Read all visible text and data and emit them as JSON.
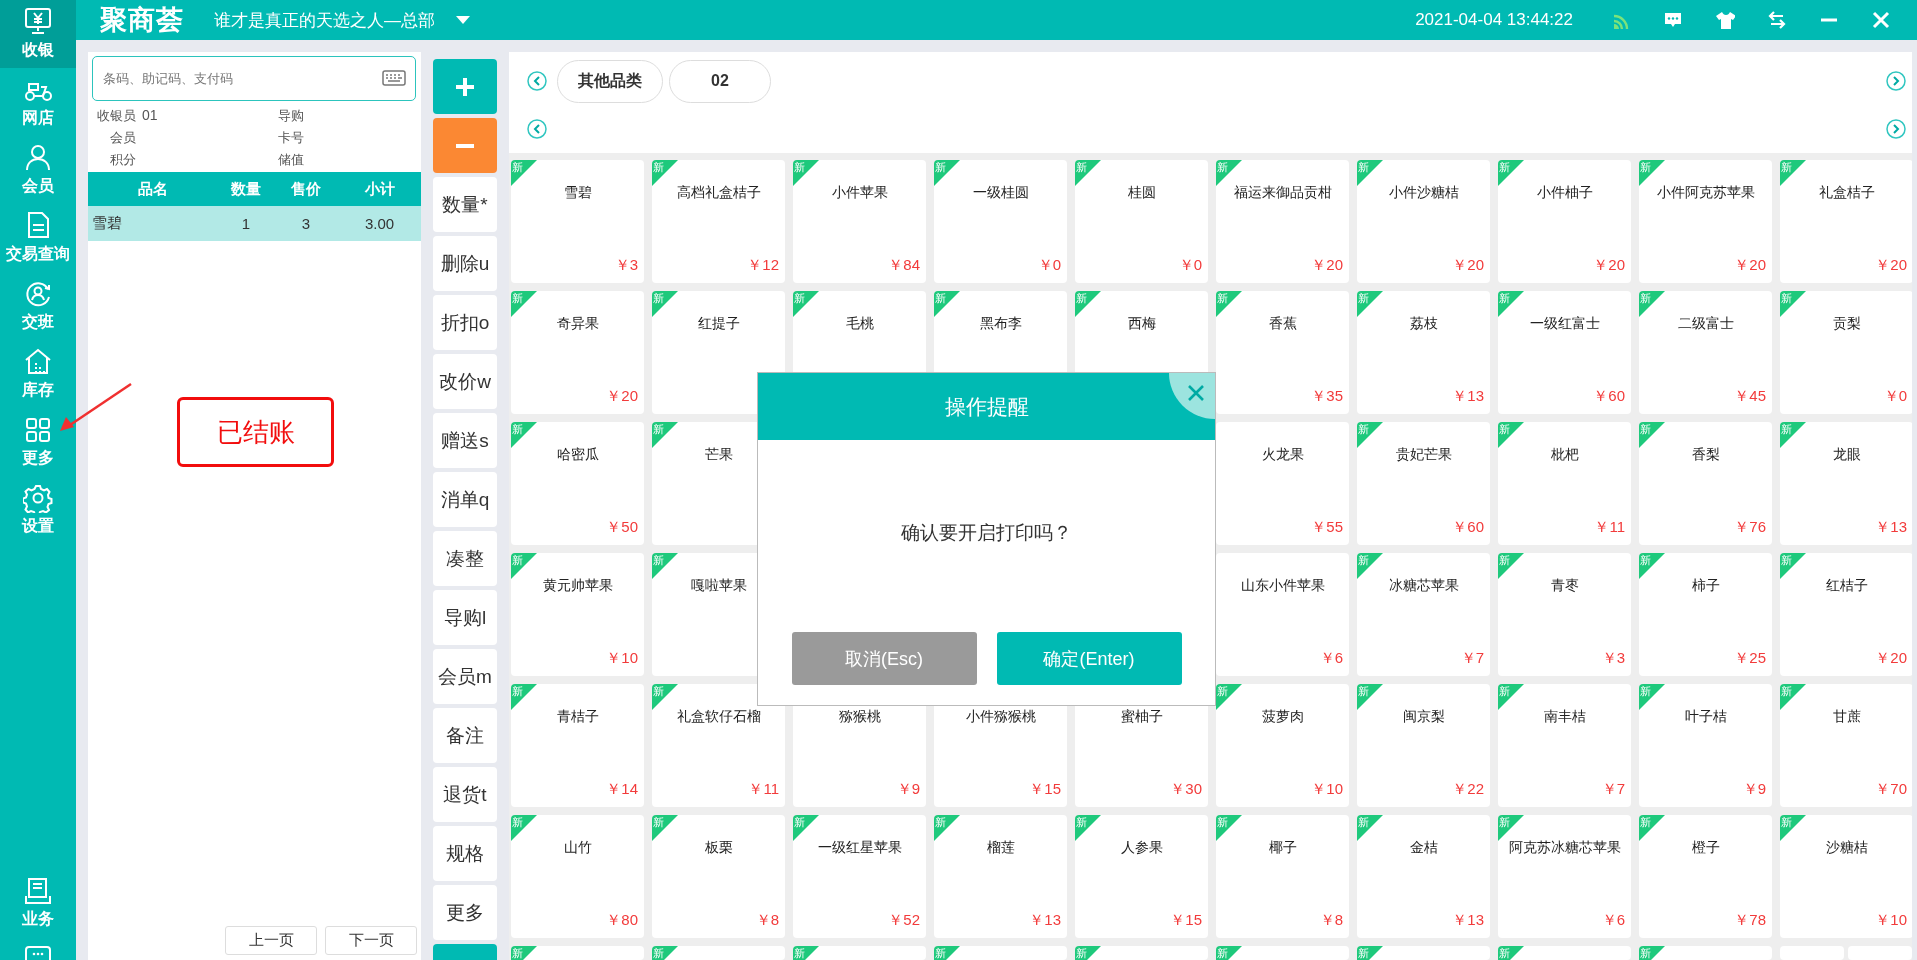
{
  "topbar": {
    "logo": "聚商荟",
    "store": "谁才是真正的天选之人—总部",
    "datetime": "2021-04-04 13:44:22"
  },
  "sidebar": {
    "items": [
      {
        "label": "收银",
        "selected": true
      },
      {
        "label": "网店",
        "selected": false
      },
      {
        "label": "会员",
        "selected": false
      },
      {
        "label": "交易查询",
        "selected": false
      },
      {
        "label": "交班",
        "selected": false
      },
      {
        "label": "库存",
        "selected": false
      },
      {
        "label": "更多",
        "selected": false
      },
      {
        "label": "设置",
        "selected": false
      }
    ],
    "bottom_items": [
      {
        "label": "业务",
        "kind": "full"
      },
      {
        "kind": "cut"
      }
    ]
  },
  "cart": {
    "search": {
      "placeholder": "条码、助记码、支付码"
    },
    "info": [
      {
        "label": "收银员",
        "value": "01"
      },
      {
        "label": "导购"
      },
      {
        "label": "会员"
      },
      {
        "label": "卡号"
      },
      {
        "label": "积分"
      },
      {
        "label": "储值"
      }
    ],
    "columns": [
      "品名",
      "数量",
      "售价",
      "小计"
    ],
    "rows": [
      {
        "cells": [
          "雪碧",
          "1",
          "3",
          "3.00"
        ],
        "selected": true
      }
    ],
    "pager": [
      "上一页",
      "下一页"
    ]
  },
  "actions": [
    {
      "kind": "add"
    },
    {
      "kind": "remove"
    },
    {
      "kind": "text",
      "label": "数量*"
    },
    {
      "kind": "text",
      "label": "删除u"
    },
    {
      "kind": "text",
      "label": "折扣o"
    },
    {
      "kind": "text",
      "label": "改价w"
    },
    {
      "kind": "text",
      "label": "赠送s"
    },
    {
      "kind": "text",
      "label": "消单q"
    },
    {
      "kind": "text",
      "label": "凑整"
    },
    {
      "kind": "text",
      "label": "导购l"
    },
    {
      "kind": "text",
      "label": "会员m"
    },
    {
      "kind": "text",
      "label": "备注"
    },
    {
      "kind": "text",
      "label": "退货t"
    },
    {
      "kind": "text",
      "label": "规格"
    },
    {
      "kind": "text",
      "label": "更多"
    },
    {
      "kind": "primary"
    }
  ],
  "categories": {
    "tabs": [
      {
        "label": "其他品类"
      },
      {
        "label": "02"
      }
    ]
  },
  "products": [
    {
      "kind": "product",
      "badge": "新",
      "name": "雪碧",
      "price": "￥3"
    },
    {
      "kind": "product",
      "badge": "新",
      "name": "高档礼盒桔子",
      "price": "￥12"
    },
    {
      "kind": "product",
      "badge": "新",
      "name": "小件苹果",
      "price": "￥84"
    },
    {
      "kind": "product",
      "badge": "新",
      "name": "一级桂圆",
      "price": "￥0"
    },
    {
      "kind": "product",
      "badge": "新",
      "name": "桂圆",
      "price": "￥0"
    },
    {
      "kind": "product",
      "badge": "新",
      "name": "福运来御品贡柑",
      "price": "￥20"
    },
    {
      "kind": "product",
      "badge": "新",
      "name": "小件沙糖桔",
      "price": "￥20"
    },
    {
      "kind": "product",
      "badge": "新",
      "name": "小件柚子",
      "price": "￥20"
    },
    {
      "kind": "product",
      "badge": "新",
      "name": "小件阿克苏苹果",
      "price": "￥20"
    },
    {
      "kind": "product",
      "badge": "新",
      "name": "礼盒桔子",
      "price": "￥20"
    },
    {
      "kind": "product",
      "badge": "新",
      "name": "奇异果",
      "price": "￥20"
    },
    {
      "kind": "product",
      "badge": "新",
      "name": "红提子"
    },
    {
      "kind": "product",
      "badge": "新",
      "name": "毛桃"
    },
    {
      "kind": "product",
      "badge": "新",
      "name": "黑布李"
    },
    {
      "kind": "product",
      "badge": "新",
      "name": "西梅"
    },
    {
      "kind": "product",
      "badge": "新",
      "name": "香蕉",
      "price": "￥35"
    },
    {
      "kind": "product",
      "badge": "新",
      "name": "荔枝",
      "price": "￥13"
    },
    {
      "kind": "product",
      "badge": "新",
      "name": "一级红富士",
      "price": "￥60"
    },
    {
      "kind": "product",
      "badge": "新",
      "name": "二级富士",
      "price": "￥45"
    },
    {
      "kind": "product",
      "badge": "新",
      "name": "贡梨",
      "price": "￥0"
    },
    {
      "kind": "product",
      "badge": "新",
      "name": "哈密瓜",
      "price": "￥50"
    },
    {
      "kind": "product",
      "badge": "新",
      "name": "芒果"
    },
    {
      "kind": "hidden"
    },
    {
      "kind": "hidden"
    },
    {
      "kind": "hidden"
    },
    {
      "kind": "product",
      "name": "火龙果",
      "price": "￥55"
    },
    {
      "kind": "product",
      "badge": "新",
      "name": "贵妃芒果",
      "price": "￥60"
    },
    {
      "kind": "product",
      "badge": "新",
      "name": "枇杷",
      "price": "￥11"
    },
    {
      "kind": "product",
      "badge": "新",
      "name": "香梨",
      "price": "￥76"
    },
    {
      "kind": "product",
      "badge": "新",
      "name": "龙眼",
      "price": "￥13"
    },
    {
      "kind": "product",
      "badge": "新",
      "name": "黄元帅苹果",
      "price": "￥10"
    },
    {
      "kind": "product",
      "badge": "新",
      "name": "嘎啦苹果"
    },
    {
      "kind": "hidden"
    },
    {
      "kind": "hidden"
    },
    {
      "kind": "hidden"
    },
    {
      "kind": "product",
      "name": "山东小件苹果",
      "price": "￥6"
    },
    {
      "kind": "product",
      "badge": "新",
      "name": "冰糖芯苹果",
      "price": "￥7"
    },
    {
      "kind": "product",
      "badge": "新",
      "name": "青枣",
      "price": "￥3"
    },
    {
      "kind": "product",
      "badge": "新",
      "name": "柿子",
      "price": "￥25"
    },
    {
      "kind": "product",
      "badge": "新",
      "name": "红桔子",
      "price": "￥20"
    },
    {
      "kind": "product",
      "badge": "新",
      "name": "青桔子",
      "price": "￥14"
    },
    {
      "kind": "product",
      "badge": "新",
      "name": "礼盒软仔石榴",
      "price": "￥11"
    },
    {
      "kind": "product",
      "name": "猕猴桃",
      "price": "￥9"
    },
    {
      "kind": "product",
      "name": "小件猕猴桃",
      "price": "￥15"
    },
    {
      "kind": "product",
      "name": "蜜柚子",
      "price": "￥30"
    },
    {
      "kind": "product",
      "badge": "新",
      "name": "菠萝肉",
      "price": "￥10"
    },
    {
      "kind": "product",
      "badge": "新",
      "name": "闽京梨",
      "price": "￥22"
    },
    {
      "kind": "product",
      "badge": "新",
      "name": "南丰桔",
      "price": "￥7"
    },
    {
      "kind": "product",
      "badge": "新",
      "name": "叶子桔",
      "price": "￥9"
    },
    {
      "kind": "product",
      "badge": "新",
      "name": "甘蔗",
      "price": "￥70"
    },
    {
      "kind": "product",
      "badge": "新",
      "name": "山竹",
      "price": "￥80"
    },
    {
      "kind": "product",
      "badge": "新",
      "name": "板栗",
      "price": "￥8"
    },
    {
      "kind": "product",
      "badge": "新",
      "name": "一级红星苹果",
      "price": "￥52"
    },
    {
      "kind": "product",
      "badge": "新",
      "name": "榴莲",
      "price": "￥13"
    },
    {
      "kind": "product",
      "badge": "新",
      "name": "人参果",
      "price": "￥15"
    },
    {
      "kind": "product",
      "badge": "新",
      "name": "椰子",
      "price": "￥8"
    },
    {
      "kind": "product",
      "badge": "新",
      "name": "金桔",
      "price": "￥13"
    },
    {
      "kind": "product",
      "badge": "新",
      "name": "阿克苏冰糖芯苹果",
      "price": "￥6"
    },
    {
      "kind": "product",
      "badge": "新",
      "name": "橙子",
      "price": "￥78"
    },
    {
      "kind": "product",
      "badge": "新",
      "name": "沙糖桔",
      "price": "￥10"
    },
    {
      "kind": "cut",
      "badge": "新"
    },
    {
      "kind": "cut",
      "badge": "新"
    },
    {
      "kind": "cut",
      "badge": "新"
    },
    {
      "kind": "cut",
      "badge": "新"
    },
    {
      "kind": "cut",
      "badge": "新"
    },
    {
      "kind": "cut",
      "badge": "新"
    },
    {
      "kind": "cut",
      "badge": "新"
    },
    {
      "kind": "cut",
      "badge": "新"
    },
    {
      "kind": "cut",
      "badge": "新"
    },
    {
      "kind": "split"
    }
  ],
  "dialog": {
    "title": "操作提醒",
    "message": "确认要开启打印吗？",
    "buttons": [
      {
        "label": "取消(Esc)",
        "kind": "cancel"
      },
      {
        "label": "确定(Enter)",
        "kind": "confirm"
      }
    ]
  },
  "annotation": {
    "text": "已结账"
  }
}
